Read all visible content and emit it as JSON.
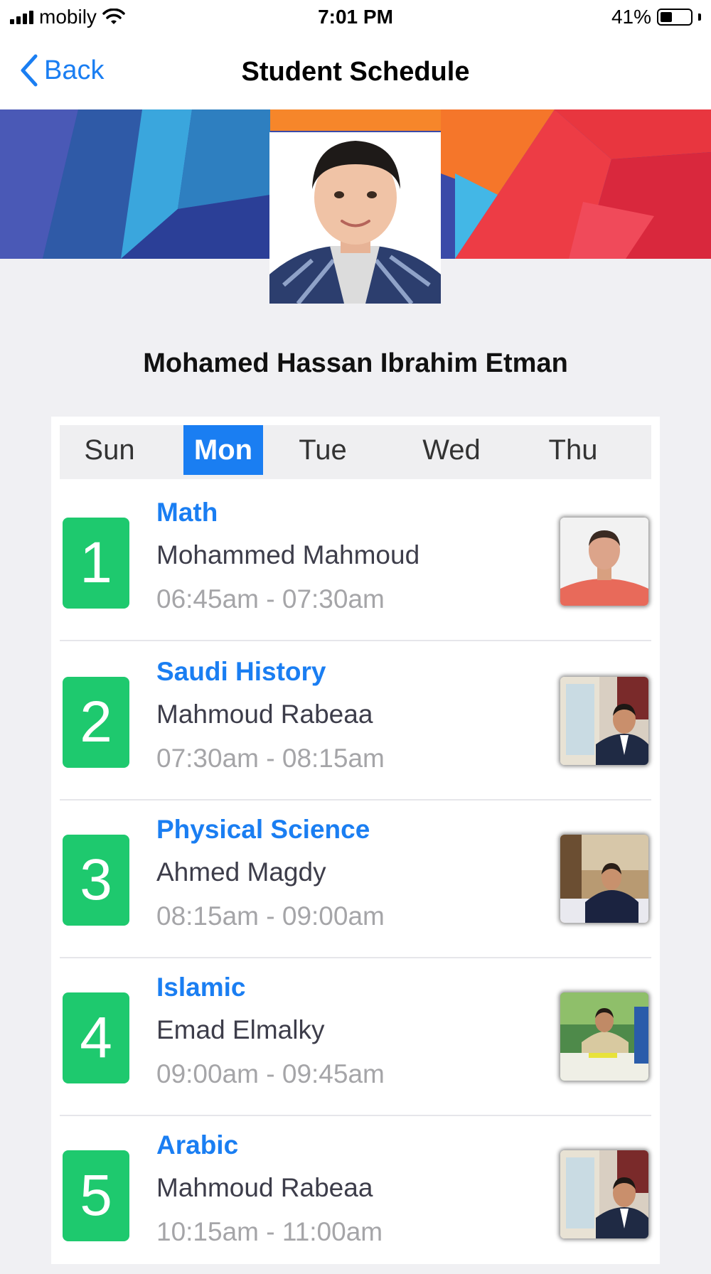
{
  "status_bar": {
    "carrier": "mobily",
    "time": "7:01 PM",
    "battery": "41%",
    "battery_level": 0.41
  },
  "nav": {
    "back_label": "Back",
    "title": "Student Schedule"
  },
  "student": {
    "name": "Mohamed Hassan Ibrahim Etman"
  },
  "days": [
    {
      "label": "Sun",
      "active": false
    },
    {
      "label": "Mon",
      "active": true
    },
    {
      "label": "Tue",
      "active": false
    },
    {
      "label": "Wed",
      "active": false
    },
    {
      "label": "Thu",
      "active": false
    }
  ],
  "lessons": [
    {
      "number": "1",
      "subject": "Math",
      "teacher": "Mohammed Mahmoud",
      "time": "06:45am - 07:30am"
    },
    {
      "number": "2",
      "subject": "Saudi History",
      "teacher": "Mahmoud Rabeaa",
      "time": "07:30am - 08:15am"
    },
    {
      "number": "3",
      "subject": "Physical Science",
      "teacher": "Ahmed Magdy",
      "time": "08:15am - 09:00am"
    },
    {
      "number": "4",
      "subject": "Islamic",
      "teacher": "Emad Elmalky",
      "time": "09:00am - 09:45am"
    },
    {
      "number": "5",
      "subject": "Arabic",
      "teacher": "Mahmoud Rabeaa",
      "time": "10:15am - 11:00am"
    }
  ],
  "colors": {
    "accent": "#1a7ef2",
    "period_badge": "#1ec96e"
  }
}
